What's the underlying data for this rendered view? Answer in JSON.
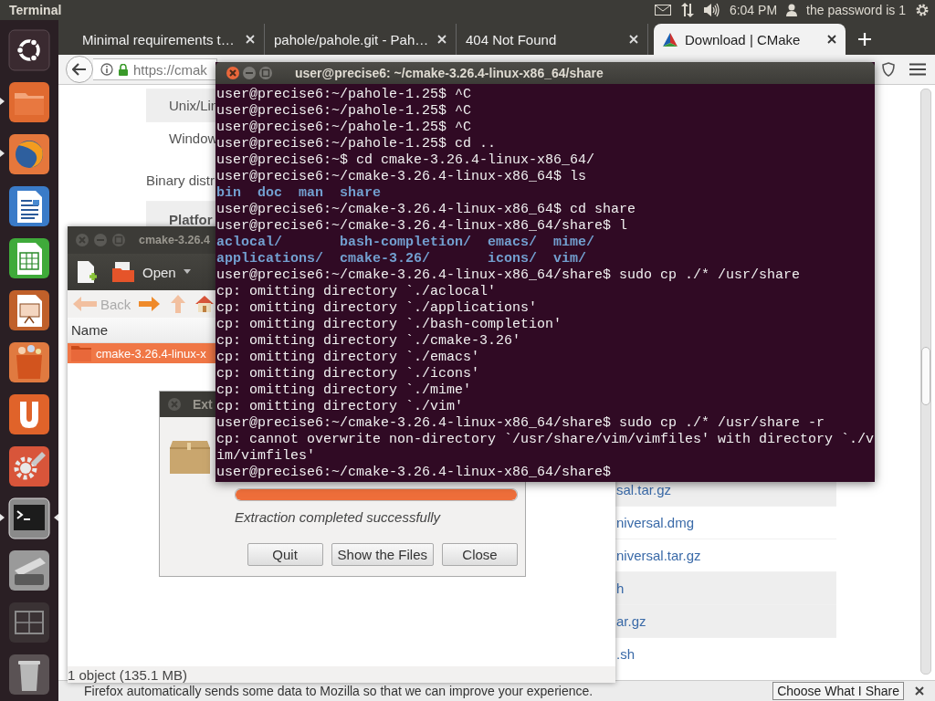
{
  "top_panel": {
    "app_title": "Terminal",
    "clock": "6:04 PM",
    "user": "the password is 1"
  },
  "launcher": [
    {
      "kind": "dash",
      "running": false,
      "focused": false
    },
    {
      "kind": "files",
      "running": true,
      "focused": false
    },
    {
      "kind": "browser",
      "running": true,
      "focused": false
    },
    {
      "kind": "writer",
      "running": false,
      "focused": false
    },
    {
      "kind": "calc",
      "running": false,
      "focused": false
    },
    {
      "kind": "impress",
      "running": false,
      "focused": false
    },
    {
      "kind": "software",
      "running": false,
      "focused": false
    },
    {
      "kind": "ubuntu_one",
      "running": false,
      "focused": false
    },
    {
      "kind": "settings",
      "running": false,
      "focused": false
    },
    {
      "kind": "terminal",
      "running": true,
      "focused": true
    },
    {
      "kind": "scanner",
      "running": false,
      "focused": false
    },
    {
      "kind": "workspaces",
      "running": false,
      "focused": false
    },
    {
      "kind": "trash",
      "running": false,
      "focused": false
    }
  ],
  "browser": {
    "tabs": [
      {
        "label": "Minimal requirements t…",
        "selected": false
      },
      {
        "label": "pahole/pahole.git - Pah…",
        "selected": false
      },
      {
        "label": "404 Not Found",
        "selected": false
      },
      {
        "label": "Download | CMake",
        "selected": true
      }
    ],
    "address": "https://cmak",
    "page": {
      "top_rows": [
        {
          "text": "Unix/Lin",
          "shaded": true
        },
        {
          "text": "Window",
          "shaded": false
        }
      ],
      "intro": "Binary distr",
      "header": "Platfor",
      "file_rows": [
        {
          "text": "sal.tar.gz",
          "shaded": true
        },
        {
          "text": "niversal.dmg",
          "shaded": false
        },
        {
          "text": "niversal.tar.gz",
          "shaded": false
        },
        {
          "text": "h",
          "shaded": true
        },
        {
          "text": "ar.gz",
          "shaded": true
        },
        {
          "text": ".sh",
          "shaded": false
        }
      ]
    },
    "notification": {
      "text": "Firefox automatically sends some data to Mozilla so that we can improve your experience.",
      "button": "Choose What I Share"
    }
  },
  "file_manager": {
    "title": "cmake-3.26.4",
    "open_label": "Open",
    "back_label": "Back",
    "column": "Name",
    "items": [
      {
        "name": "cmake-3.26.4-linux-x",
        "selected": true
      }
    ],
    "status": "1 object (135.1 MB)"
  },
  "dialog": {
    "title": "Ext",
    "level": 1,
    "message": "Extraction completed successfully",
    "buttons": [
      "Quit",
      "Show the Files",
      "Close"
    ]
  },
  "terminal": {
    "title": "user@precise6: ~/cmake-3.26.4-linux-x86_64/share",
    "lines": [
      {
        "kind": "text",
        "text": "user@precise6:~/pahole-1.25$ ^C"
      },
      {
        "kind": "text",
        "text": "user@precise6:~/pahole-1.25$ ^C"
      },
      {
        "kind": "text",
        "text": "user@precise6:~/pahole-1.25$ ^C"
      },
      {
        "kind": "text",
        "text": "user@precise6:~/pahole-1.25$ cd .."
      },
      {
        "kind": "text",
        "text": "user@precise6:~$ cd cmake-3.26.4-linux-x86_64/"
      },
      {
        "kind": "text",
        "text": "user@precise6:~/cmake-3.26.4-linux-x86_64$ ls"
      },
      {
        "kind": "listing",
        "rows": [
          [
            "bin",
            "doc",
            "man",
            "share"
          ]
        ]
      },
      {
        "kind": "text",
        "text": "user@precise6:~/cmake-3.26.4-linux-x86_64$ cd share"
      },
      {
        "kind": "text",
        "text": "user@precise6:~/cmake-3.26.4-linux-x86_64/share$ l"
      },
      {
        "kind": "listing",
        "rows": [
          [
            "aclocal/",
            "bash-completion/",
            "emacs/",
            "mime/"
          ],
          [
            "applications/",
            "cmake-3.26/",
            "icons/",
            "vim/"
          ]
        ]
      },
      {
        "kind": "text",
        "text": "user@precise6:~/cmake-3.26.4-linux-x86_64/share$ sudo cp ./* /usr/share"
      },
      {
        "kind": "text",
        "text": "cp: omitting directory `./aclocal'"
      },
      {
        "kind": "text",
        "text": "cp: omitting directory `./applications'"
      },
      {
        "kind": "text",
        "text": "cp: omitting directory `./bash-completion'"
      },
      {
        "kind": "text",
        "text": "cp: omitting directory `./cmake-3.26'"
      },
      {
        "kind": "text",
        "text": "cp: omitting directory `./emacs'"
      },
      {
        "kind": "text",
        "text": "cp: omitting directory `./icons'"
      },
      {
        "kind": "text",
        "text": "cp: omitting directory `./mime'"
      },
      {
        "kind": "text",
        "text": "cp: omitting directory `./vim'"
      },
      {
        "kind": "text",
        "text": "user@precise6:~/cmake-3.26.4-linux-x86_64/share$ sudo cp ./* /usr/share -r"
      },
      {
        "kind": "text",
        "text": "cp: cannot overwrite non-directory `/usr/share/vim/vimfiles' with directory `./v"
      },
      {
        "kind": "text",
        "text": "im/vimfiles'"
      },
      {
        "kind": "text",
        "text": "user@precise6:~/cmake-3.26.4-linux-x86_64/share$"
      }
    ]
  }
}
